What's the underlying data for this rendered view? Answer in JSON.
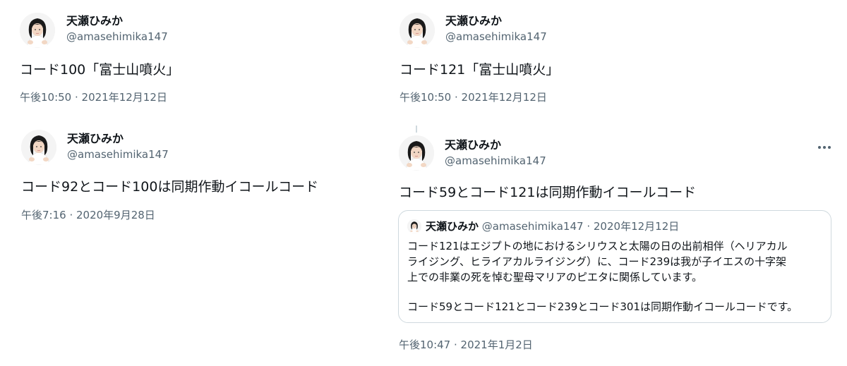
{
  "tweets": [
    {
      "name": "天瀬ひみか",
      "handle": "@amasehimika147",
      "text": "コード100「富士山噴火」",
      "meta": "午後10:50 · 2021年12月12日"
    },
    {
      "name": "天瀬ひみか",
      "handle": "@amasehimika147",
      "text": "コード92とコード100は同期作動イコールコード",
      "meta": "午後7:16 · 2020年9月28日"
    },
    {
      "name": "天瀬ひみか",
      "handle": "@amasehimika147",
      "text": "コード121「富士山噴火」",
      "meta": "午後10:50 · 2021年12月12日"
    },
    {
      "name": "天瀬ひみか",
      "handle": "@amasehimika147",
      "text": "コード59とコード121は同期作動イコールコード",
      "meta": "午後10:47 · 2021年1月2日",
      "more_icon": "more-horizontal-icon",
      "quote": {
        "name": "天瀬ひみか",
        "handle": "@amasehimika147",
        "separator": "·",
        "date": "2020年12月12日",
        "lines": [
          "コード121はエジプトの地におけるシリウスと太陽の日の出前相伴（ヘリアカル",
          "ライジング、ヒライアカルライジング）に、コード239は我が子イエスの十字架",
          "上での非業の死を悼む聖母マリアのピエタに関係しています。",
          "",
          "コード59とコード121とコード239とコード301は同期作動イコールコードです。"
        ]
      }
    }
  ],
  "colors": {
    "text": "#0f1419",
    "secondary": "#536471",
    "border": "#cfd9de"
  }
}
